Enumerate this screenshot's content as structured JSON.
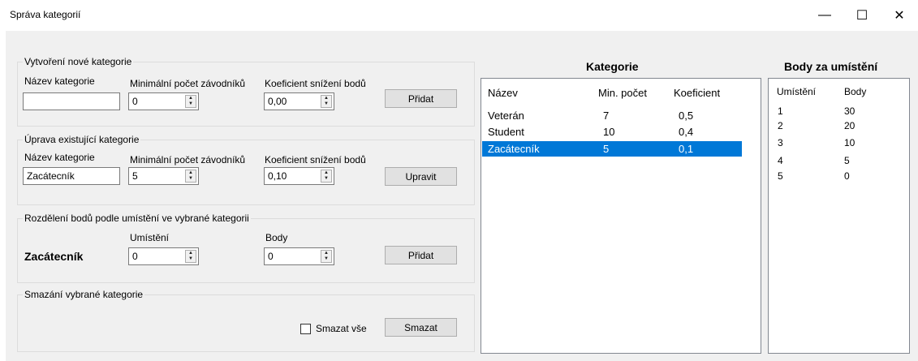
{
  "window": {
    "title": "Správa kategorií",
    "minimize": "—",
    "maximize": "☐",
    "close": "✕"
  },
  "new_category": {
    "legend": "Vytvoření nové kategorie",
    "name_label": "Název kategorie",
    "name_value": "",
    "min_label": "Minimální počet závodníků",
    "min_value": "0",
    "coef_label": "Koeficient snížení bodů",
    "coef_value": "0,00",
    "button": "Přidat"
  },
  "edit_category": {
    "legend": "Úprava existující kategorie",
    "name_label": "Název kategorie",
    "name_value": "Zacátecník",
    "min_label": "Minimální počet závodníků",
    "min_value": "5",
    "coef_label": "Koeficient snížení bodů",
    "coef_value": "0,10",
    "button": "Upravit"
  },
  "points": {
    "legend": "Rozdělení bodů podle umístění ve vybrané kategorii",
    "selected": "Zacátecník",
    "place_label": "Umístění",
    "place_value": "0",
    "points_label": "Body",
    "points_value": "0",
    "button": "Přidat"
  },
  "delete": {
    "legend": "Smazání vybrané kategorie",
    "checkbox_label": "Smazat vše",
    "checked": false,
    "button": "Smazat"
  },
  "categories": {
    "heading": "Kategorie",
    "columns": [
      "Název",
      "Min. počet",
      "Koeficient"
    ],
    "rows": [
      [
        "Veterán",
        "7",
        "0,5"
      ],
      [
        "Student",
        "10",
        "0,4"
      ],
      [
        "Zacátecník",
        "5",
        "0,1"
      ]
    ],
    "selected_index": 2
  },
  "placements": {
    "heading": "Body za umístění",
    "columns": [
      "Umístění",
      "Body"
    ],
    "rows": [
      [
        "1",
        "30"
      ],
      [
        "2",
        "20"
      ],
      [
        "3",
        "10"
      ],
      [
        "4",
        "5"
      ],
      [
        "5",
        "0"
      ]
    ]
  },
  "colors": {
    "selection": "#0078d7",
    "background": "#f0f0f0"
  }
}
